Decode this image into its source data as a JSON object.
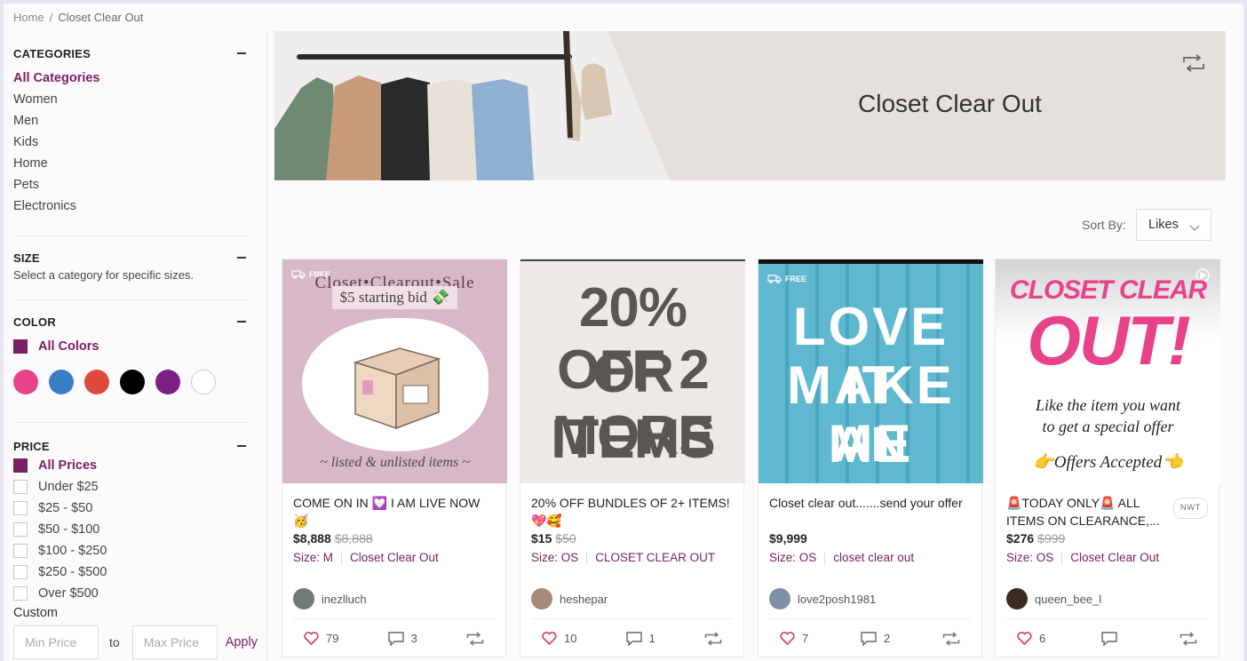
{
  "breadcrumb": {
    "home": "Home",
    "sep": "/",
    "current": "Closet Clear Out"
  },
  "sidebar": {
    "categories": {
      "title": "CATEGORIES",
      "items": [
        "All Categories",
        "Women",
        "Men",
        "Kids",
        "Home",
        "Pets",
        "Electronics"
      ]
    },
    "size": {
      "title": "SIZE",
      "note": "Select a category for specific sizes."
    },
    "color": {
      "title": "COLOR",
      "all_label": "All Colors",
      "swatches": [
        "#e8428a",
        "#3a7fc6",
        "#de4a3d",
        "#000000",
        "#7b1f86",
        "#ffffff"
      ]
    },
    "price": {
      "title": "PRICE",
      "options": [
        "All Prices",
        "Under $25",
        "$25 - $50",
        "$50 - $100",
        "$100 - $250",
        "$250 - $500",
        "Over $500"
      ],
      "custom_label": "Custom",
      "min_placeholder": "Min Price",
      "to_label": "to",
      "max_placeholder": "Max Price",
      "apply_label": "Apply"
    }
  },
  "banner": {
    "title": "Closet Clear Out"
  },
  "sort": {
    "label": "Sort By:",
    "value": "Likes"
  },
  "cards": [
    {
      "free": "FREE",
      "img_text": [
        "Closet•Clearout•Sale",
        "$5 starting bid 💸",
        "~ listed & unlisted items ~"
      ],
      "title": "COME ON IN 💟 I AM LIVE NOW 🥳",
      "price": "$8,888",
      "orig": "$8,888",
      "size": "Size: M",
      "brand": "Closet Clear Out",
      "seller": "inezlluch",
      "likes": "79",
      "comments": "3"
    },
    {
      "img_text": [
        "20% OFF 2",
        "OR MORE",
        "ITEMS"
      ],
      "title": "20% OFF BUNDLES OF 2+ ITEMS! 💖🥰",
      "price": "$15",
      "orig": "$50",
      "size": "Size: OS",
      "brand": "CLOSET CLEAR OUT",
      "seller": "heshepar",
      "likes": "10",
      "comments": "1"
    },
    {
      "free": "FREE",
      "img_text": [
        "LOVE IT",
        "MAKE ME",
        "AN OFFER"
      ],
      "title": "Closet clear out.......send your offer",
      "price": "$9,999",
      "orig": "",
      "size": "Size: OS",
      "brand": "closet clear out",
      "seller": "love2posh1981",
      "likes": "7",
      "comments": "2"
    },
    {
      "img_text": [
        "CLOSET CLEAR",
        "OUT!",
        "Like the item you want",
        "to get a special offer",
        "👉Offers Accepted👈"
      ],
      "title": "🚨TODAY ONLY🚨 ALL ITEMS ON CLEARANCE,...",
      "badge": "NWT",
      "price": "$276",
      "orig": "$999",
      "size": "Size: OS",
      "brand": "Closet Clear Out",
      "seller": "queen_bee_l",
      "likes": "6",
      "comments": ""
    }
  ],
  "colors": {
    "accent": "#7a2163"
  }
}
